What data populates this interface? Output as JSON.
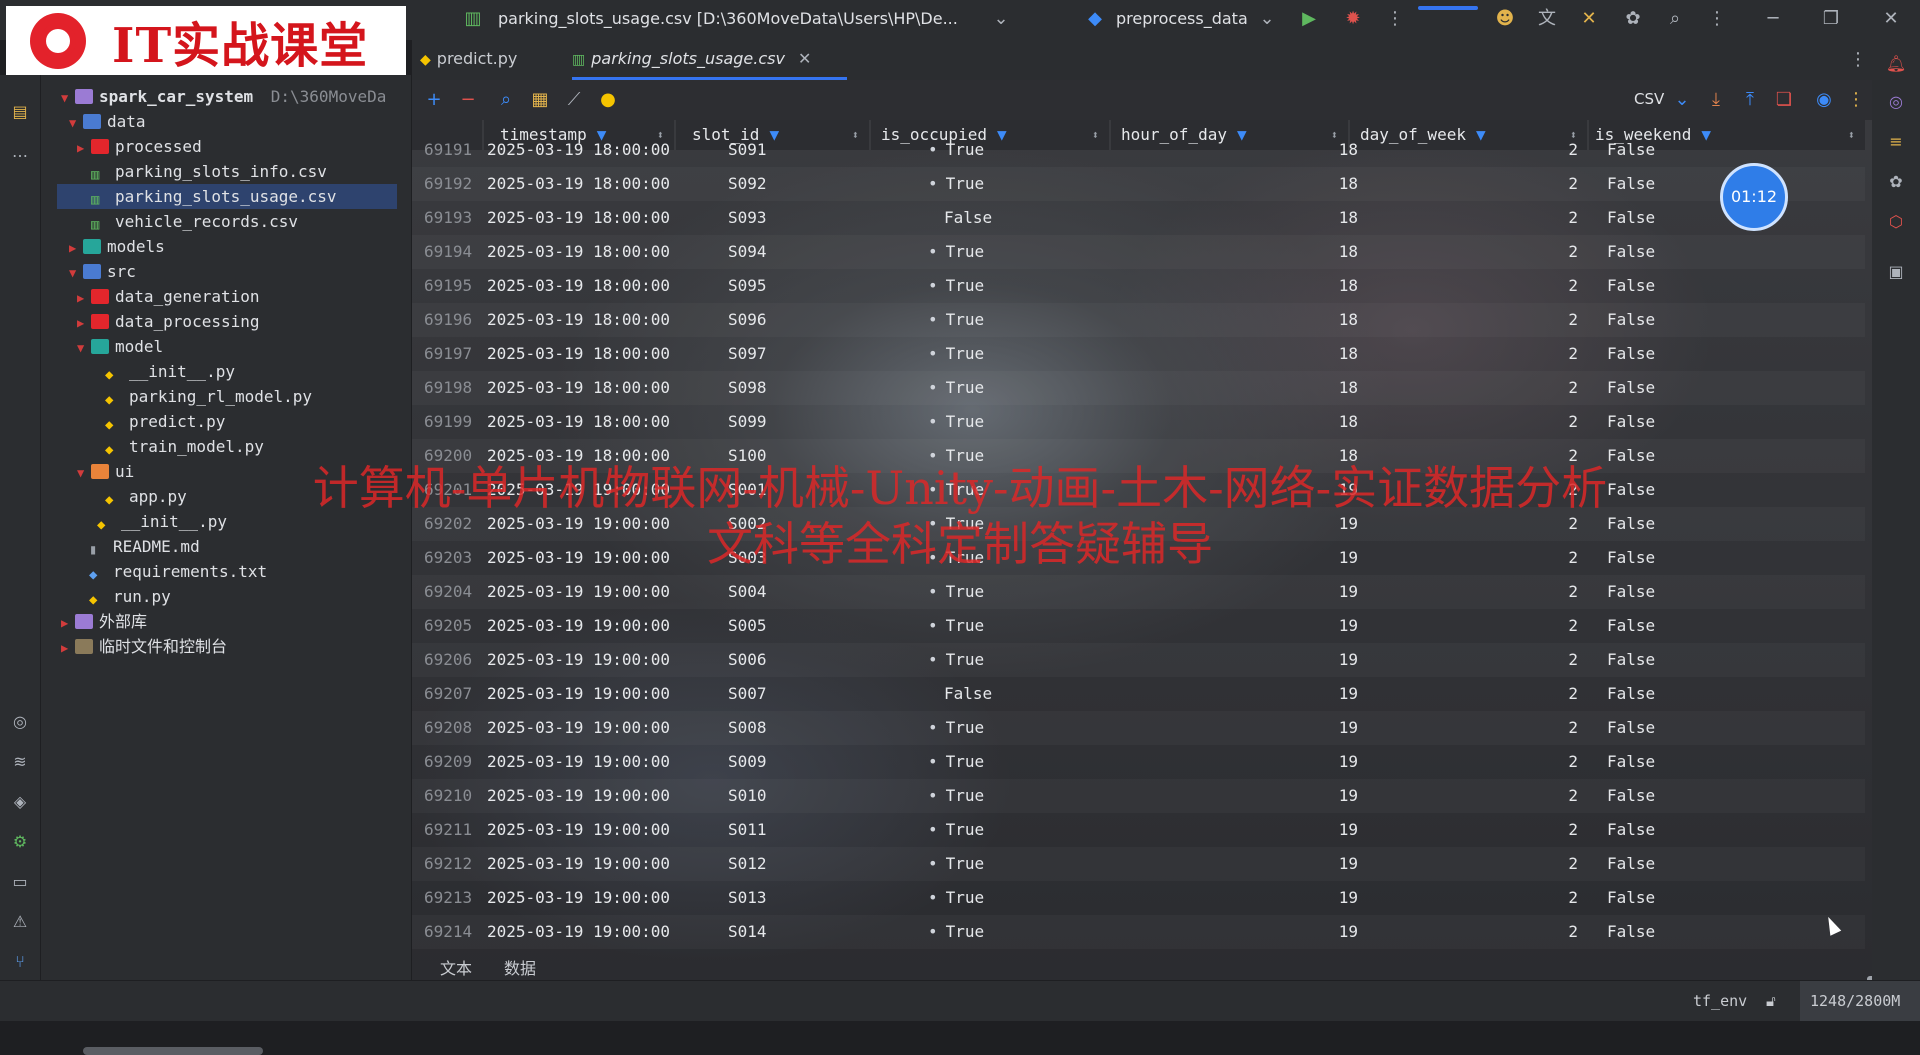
{
  "logo": {
    "text": "IT实战课堂"
  },
  "titlebar": {
    "file_title": "parking_slots_usage.csv [D:\\360MoveData\\Users\\HP\\De...",
    "run_config": "preprocess_data"
  },
  "tabs": [
    {
      "label": "predict.py"
    },
    {
      "label": "parking_slots_usage.csv"
    }
  ],
  "project": {
    "root_name": "spark_car_system",
    "root_path": "D:\\360MoveDa",
    "items": [
      {
        "label": "data"
      },
      {
        "label": "processed"
      },
      {
        "label": "parking_slots_info.csv"
      },
      {
        "label": "parking_slots_usage.csv"
      },
      {
        "label": "vehicle_records.csv"
      },
      {
        "label": "models"
      },
      {
        "label": "src"
      },
      {
        "label": "data_generation"
      },
      {
        "label": "data_processing"
      },
      {
        "label": "model"
      },
      {
        "label": "__init__.py"
      },
      {
        "label": "parking_rl_model.py"
      },
      {
        "label": "predict.py"
      },
      {
        "label": "train_model.py"
      },
      {
        "label": "ui"
      },
      {
        "label": "app.py"
      },
      {
        "label": "__init__.py"
      },
      {
        "label": "README.md"
      },
      {
        "label": "requirements.txt"
      },
      {
        "label": "run.py"
      },
      {
        "label": "外部库"
      },
      {
        "label": "临时文件和控制台"
      }
    ]
  },
  "toolbar": {
    "format": "CSV"
  },
  "table": {
    "columns": [
      "timestamp",
      "slot_id",
      "is_occupied",
      "hour_of_day",
      "day_of_week",
      "is_weekend"
    ],
    "rows": [
      [
        "69191",
        "2025-03-19 18:00:00",
        "S091",
        "True",
        "18",
        "2",
        "False"
      ],
      [
        "69192",
        "2025-03-19 18:00:00",
        "S092",
        "True",
        "18",
        "2",
        "False"
      ],
      [
        "69193",
        "2025-03-19 18:00:00",
        "S093",
        "False",
        "18",
        "2",
        "False"
      ],
      [
        "69194",
        "2025-03-19 18:00:00",
        "S094",
        "True",
        "18",
        "2",
        "False"
      ],
      [
        "69195",
        "2025-03-19 18:00:00",
        "S095",
        "True",
        "18",
        "2",
        "False"
      ],
      [
        "69196",
        "2025-03-19 18:00:00",
        "S096",
        "True",
        "18",
        "2",
        "False"
      ],
      [
        "69197",
        "2025-03-19 18:00:00",
        "S097",
        "True",
        "18",
        "2",
        "False"
      ],
      [
        "69198",
        "2025-03-19 18:00:00",
        "S098",
        "True",
        "18",
        "2",
        "False"
      ],
      [
        "69199",
        "2025-03-19 18:00:00",
        "S099",
        "True",
        "18",
        "2",
        "False"
      ],
      [
        "69200",
        "2025-03-19 18:00:00",
        "S100",
        "True",
        "18",
        "2",
        "False"
      ],
      [
        "69201",
        "2025-03-19 19:00:00",
        "S001",
        "True",
        "19",
        "2",
        "False"
      ],
      [
        "69202",
        "2025-03-19 19:00:00",
        "S002",
        "True",
        "19",
        "2",
        "False"
      ],
      [
        "69203",
        "2025-03-19 19:00:00",
        "S003",
        "True",
        "19",
        "2",
        "False"
      ],
      [
        "69204",
        "2025-03-19 19:00:00",
        "S004",
        "True",
        "19",
        "2",
        "False"
      ],
      [
        "69205",
        "2025-03-19 19:00:00",
        "S005",
        "True",
        "19",
        "2",
        "False"
      ],
      [
        "69206",
        "2025-03-19 19:00:00",
        "S006",
        "True",
        "19",
        "2",
        "False"
      ],
      [
        "69207",
        "2025-03-19 19:00:00",
        "S007",
        "False",
        "19",
        "2",
        "False"
      ],
      [
        "69208",
        "2025-03-19 19:00:00",
        "S008",
        "True",
        "19",
        "2",
        "False"
      ],
      [
        "69209",
        "2025-03-19 19:00:00",
        "S009",
        "True",
        "19",
        "2",
        "False"
      ],
      [
        "69210",
        "2025-03-19 19:00:00",
        "S010",
        "True",
        "19",
        "2",
        "False"
      ],
      [
        "69211",
        "2025-03-19 19:00:00",
        "S011",
        "True",
        "19",
        "2",
        "False"
      ],
      [
        "69212",
        "2025-03-19 19:00:00",
        "S012",
        "True",
        "19",
        "2",
        "False"
      ],
      [
        "69213",
        "2025-03-19 19:00:00",
        "S013",
        "True",
        "19",
        "2",
        "False"
      ],
      [
        "69214",
        "2025-03-19 19:00:00",
        "S014",
        "True",
        "19",
        "2",
        "False"
      ]
    ]
  },
  "bottom_tabs": [
    "文本",
    "数据"
  ],
  "status": {
    "env": "tf_env",
    "memory": "1248/2800M"
  },
  "overlay": {
    "watermark_line1": "计算机-单片机物联网-机械-Unity-动画-土木-网络-实证数据分析",
    "watermark_line2": "文科等全科定制答疑辅导",
    "timer": "01:12"
  },
  "colors": {
    "accent": "#3574f0",
    "filter_icon": "#3d8bf8",
    "watermark": "#dc2828",
    "selection": "#2e436e"
  }
}
